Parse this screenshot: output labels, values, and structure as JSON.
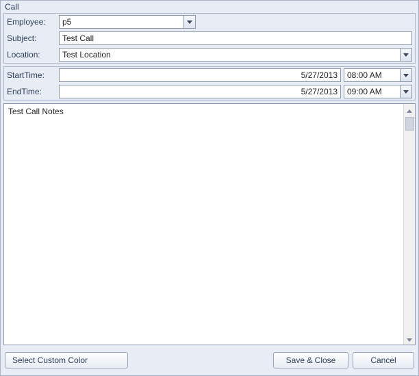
{
  "window": {
    "title": "Call"
  },
  "fields": {
    "employee_label": "Employee:",
    "employee_value": "p5",
    "subject_label": "Subject:",
    "subject_value": "Test Call",
    "location_label": "Location:",
    "location_value": "Test Location",
    "start_label": "StartTime:",
    "start_date": "5/27/2013",
    "start_time": "08:00 AM",
    "end_label": "EndTime:",
    "end_date": "5/27/2013",
    "end_time": "09:00 AM"
  },
  "notes": {
    "value": "Test Call Notes"
  },
  "buttons": {
    "select_color": "Select Custom Color",
    "save_close": "Save & Close",
    "cancel": "Cancel"
  }
}
